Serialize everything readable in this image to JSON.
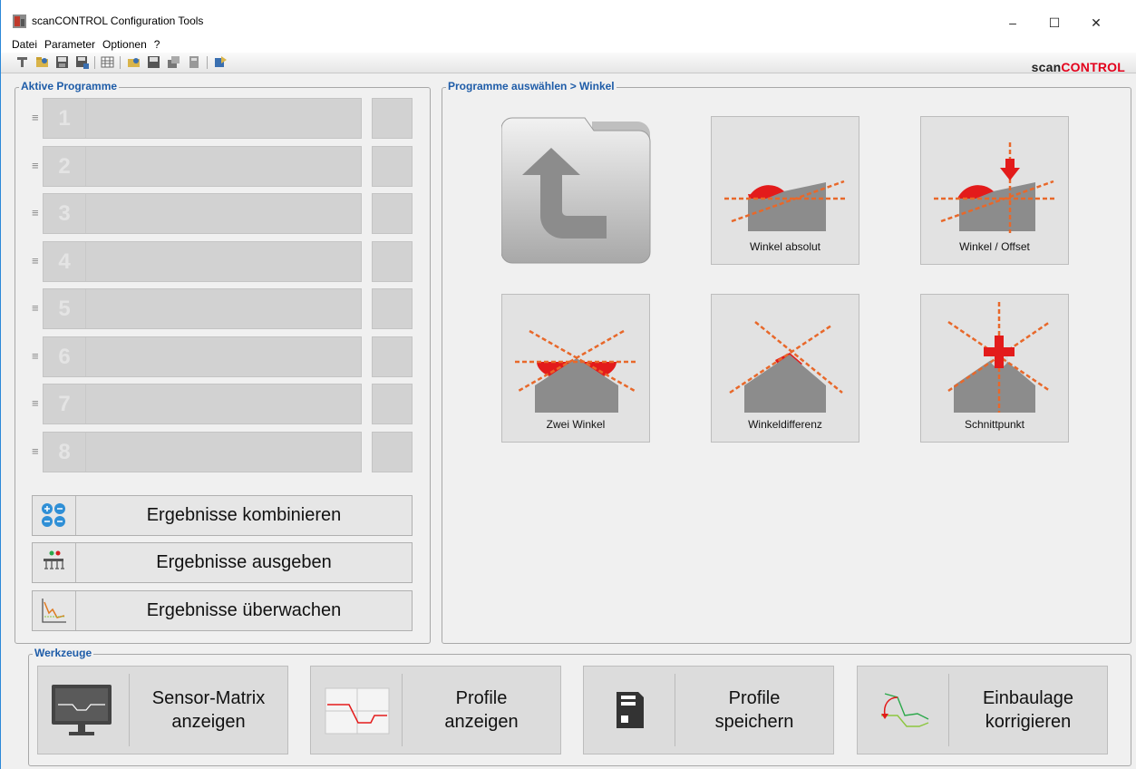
{
  "window": {
    "title": "scanCONTROL Configuration Tools",
    "controls": {
      "minimize": "–",
      "maximize": "☐",
      "close": "✕"
    }
  },
  "menu": [
    "Datei",
    "Parameter",
    "Optionen",
    "?"
  ],
  "brand": {
    "part1": "scan",
    "part2": "CONTROL",
    "accent_color": "#e3001b"
  },
  "left_panel": {
    "title": "Aktive Programme",
    "programs": [
      "1",
      "2",
      "3",
      "4",
      "5",
      "6",
      "7",
      "8"
    ],
    "handle_glyph": "≡",
    "result_buttons": [
      {
        "label": "Ergebnisse kombinieren",
        "icon": "combine-results-icon"
      },
      {
        "label": "Ergebnisse ausgeben",
        "icon": "output-results-icon"
      },
      {
        "label": "Ergebnisse überwachen",
        "icon": "monitor-results-icon"
      }
    ]
  },
  "right_panel": {
    "title": "Programme auswählen > Winkel",
    "tiles": [
      {
        "label": "",
        "icon": "back-folder-icon"
      },
      {
        "label": "Winkel absolut",
        "icon": "absolute-angle-icon"
      },
      {
        "label": "Winkel / Offset",
        "icon": "angle-offset-icon"
      },
      {
        "label": "Zwei Winkel",
        "icon": "two-angles-icon"
      },
      {
        "label": "Winkeldifferenz",
        "icon": "angle-difference-icon"
      },
      {
        "label": "Schnittpunkt",
        "icon": "intersection-icon"
      }
    ]
  },
  "tools": {
    "title": "Werkzeuge",
    "buttons": [
      {
        "line1": "Sensor-Matrix",
        "line2": "anzeigen",
        "icon": "monitor-icon"
      },
      {
        "line1": "Profile",
        "line2": "anzeigen",
        "icon": "profile-chart-icon"
      },
      {
        "line1": "Profile",
        "line2": "speichern",
        "icon": "save-disk-icon"
      },
      {
        "line1": "Einbaulage",
        "line2": "korrigieren",
        "icon": "correct-position-icon"
      }
    ]
  }
}
